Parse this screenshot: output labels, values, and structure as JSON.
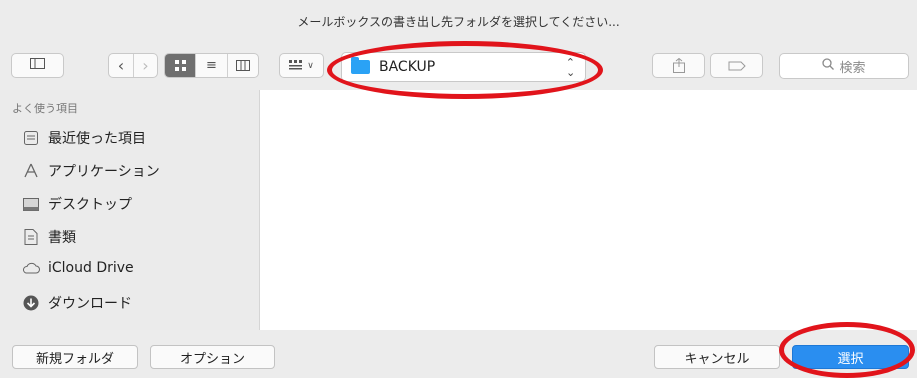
{
  "window": {
    "title": "メールボックスの書き出し先フォルダを選択してください..."
  },
  "toolbar": {
    "location": "BACKUP",
    "search_placeholder": "検索"
  },
  "sidebar": {
    "heading": "よく使う項目",
    "items": [
      {
        "label": "最近使った項目",
        "icon": "recent-items-icon"
      },
      {
        "label": "アプリケーション",
        "icon": "applications-icon"
      },
      {
        "label": "デスクトップ",
        "icon": "desktop-icon"
      },
      {
        "label": "書類",
        "icon": "documents-icon"
      },
      {
        "label": "iCloud Drive",
        "icon": "cloud-icon"
      },
      {
        "label": "ダウンロード",
        "icon": "downloads-icon"
      }
    ]
  },
  "footer": {
    "new_folder": "新規フォルダ",
    "options": "オプション",
    "cancel": "キャンセル",
    "choose": "選択"
  },
  "annotation_color": "#e1141b",
  "accent_color": "#2a8ef0"
}
